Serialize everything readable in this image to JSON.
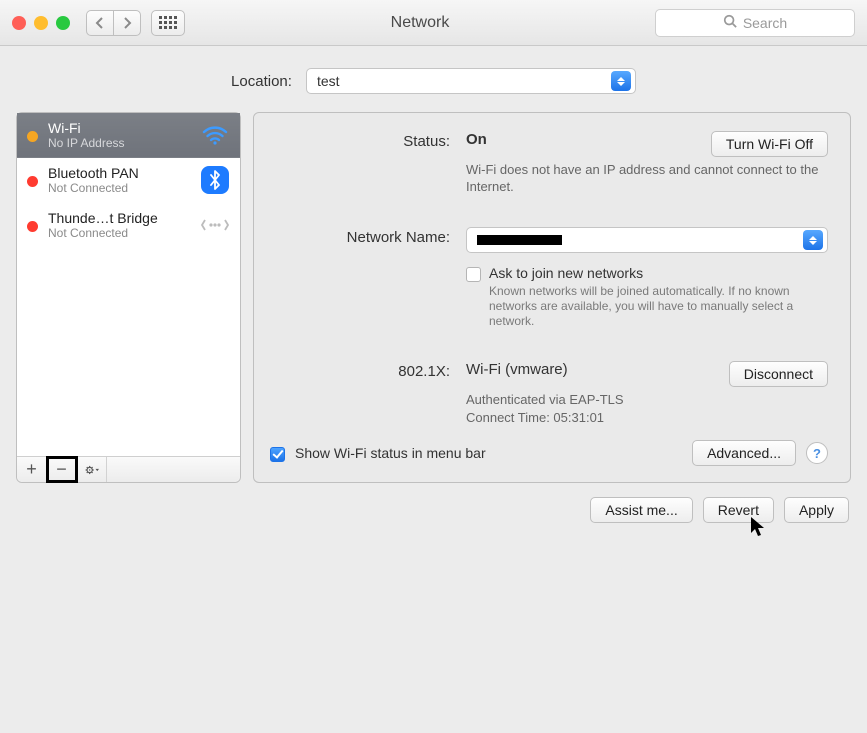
{
  "window": {
    "title": "Network"
  },
  "search": {
    "placeholder": "Search"
  },
  "location": {
    "label": "Location:",
    "value": "test"
  },
  "sidebar": {
    "services": [
      {
        "name": "Wi-Fi",
        "sub": "No IP Address",
        "status": "orange",
        "icon": "wifi",
        "selected": true
      },
      {
        "name": "Bluetooth PAN",
        "sub": "Not Connected",
        "status": "red",
        "icon": "bluetooth",
        "selected": false
      },
      {
        "name": "Thunde…t Bridge",
        "sub": "Not Connected",
        "status": "red",
        "icon": "thunderbolt",
        "selected": false
      }
    ]
  },
  "status": {
    "label": "Status:",
    "value": "On",
    "toggle_button": "Turn Wi-Fi Off",
    "desc": "Wi-Fi does not have an IP address and cannot connect to the Internet."
  },
  "network_name": {
    "label": "Network Name:",
    "value": "",
    "ask_join_label": "Ask to join new networks",
    "ask_join_checked": false,
    "hint": "Known networks will be joined automatically. If no known networks are available, you will have to manually select a network."
  },
  "dot1x": {
    "label": "802.1X:",
    "profile": "Wi-Fi (vmware)",
    "disconnect": "Disconnect",
    "auth_line": "Authenticated via EAP-TLS",
    "time_line": "Connect Time: 05:31:01"
  },
  "menubar": {
    "show_status_label": "Show Wi-Fi status in menu bar",
    "show_status_checked": true,
    "advanced": "Advanced..."
  },
  "footer": {
    "assist": "Assist me...",
    "revert": "Revert",
    "apply": "Apply"
  }
}
